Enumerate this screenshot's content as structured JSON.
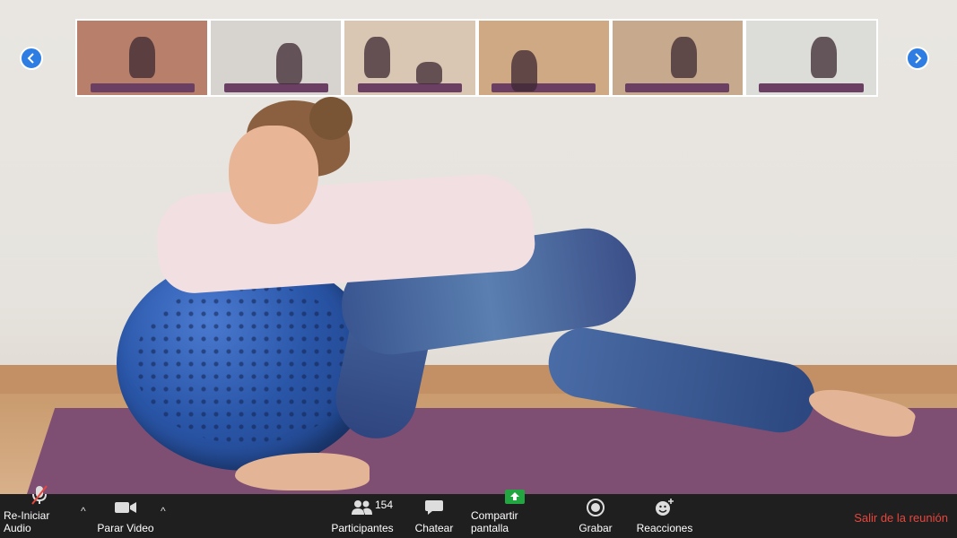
{
  "thumbnails": [
    {
      "label": "participant-1",
      "bg": "#b87f6a"
    },
    {
      "label": "participant-2",
      "bg": "#d7d4cf"
    },
    {
      "label": "participant-3",
      "bg": "#d9c7b3"
    },
    {
      "label": "participant-4",
      "bg": "#cfa884"
    },
    {
      "label": "participant-5",
      "bg": "#c7a98d"
    },
    {
      "label": "participant-6",
      "bg": "#dcdcd8"
    }
  ],
  "nav": {
    "prev_icon": "chevron-left-icon",
    "next_icon": "chevron-right-icon"
  },
  "toolbar": {
    "audio_label": "Re-Iniciar Audio",
    "video_label": "Parar Video",
    "participants_label": "Participantes",
    "participants_count": "154",
    "chat_label": "Chatear",
    "share_label": "Compartir pantalla",
    "record_label": "Grabar",
    "reactions_label": "Reacciones",
    "leave_label": "Salir de la reunión",
    "accent": "#2d7de3",
    "share_color": "#23a641",
    "leave_color": "#e8463d"
  }
}
